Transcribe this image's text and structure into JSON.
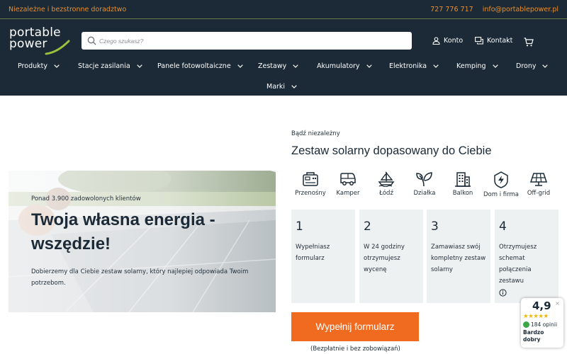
{
  "topbar": {
    "tagline": "Niezależne i bezstronne doradztwo",
    "phone": "727 776 717",
    "email": "info@portablepower.pl"
  },
  "logo": {
    "line1": "portable",
    "line2": "power"
  },
  "search": {
    "placeholder": "Czego szukasz?"
  },
  "header_links": {
    "account": "Konto",
    "contact": "Kontakt"
  },
  "nav": [
    "Produkty",
    "Stacje zasilania",
    "Panele fotowoltaiczne",
    "Zestawy",
    "Akumulatory",
    "Elektronika",
    "Kemping",
    "Drony",
    "Marki"
  ],
  "hero": {
    "subtitle": "Ponad 3.900 zadowolonych klientów",
    "title": "Twoja własna energia - wszędzie!",
    "description": "Dobierzemy dla Ciebie zestaw solarny, który najlepiej odpowiada Twoim potrzebom."
  },
  "offer": {
    "eyebrow": "Bądź niezależny",
    "title": "Zestaw solarny dopasowany do Ciebie"
  },
  "categories": [
    {
      "label": "Przenośny",
      "icon": "portable-station-icon"
    },
    {
      "label": "Kamper",
      "icon": "camper-icon"
    },
    {
      "label": "Łódź",
      "icon": "boat-icon"
    },
    {
      "label": "Działka",
      "icon": "leaf-icon"
    },
    {
      "label": "Balkon",
      "icon": "building-icon"
    },
    {
      "label": "Dom i firma",
      "icon": "bolt-shield-icon"
    },
    {
      "label": "Off-grid",
      "icon": "solar-panel-icon"
    }
  ],
  "steps": [
    {
      "number": "1",
      "text": "Wypełniasz formularz"
    },
    {
      "number": "2",
      "text": "W 24 godziny otrzymujesz wycenę"
    },
    {
      "number": "3",
      "text": "Zamawiasz swój kompletny zestaw solarny"
    },
    {
      "number": "4",
      "text": "Otrzymujesz schemat połączenia zestawu"
    }
  ],
  "cta": {
    "label": "Wypełnij formularz",
    "note": "(Bezpłatnie i bez zobowiązań)"
  },
  "rating": {
    "score": "4,9",
    "close": "×",
    "stars": "★★★★★",
    "count": "184 opinii",
    "label": "Bardzo dobry"
  },
  "colors": {
    "header_bg": "#1b2a36",
    "accent": "#f06a1f",
    "topbar_text": "#e8902e",
    "step_bg": "#eef1f2"
  }
}
